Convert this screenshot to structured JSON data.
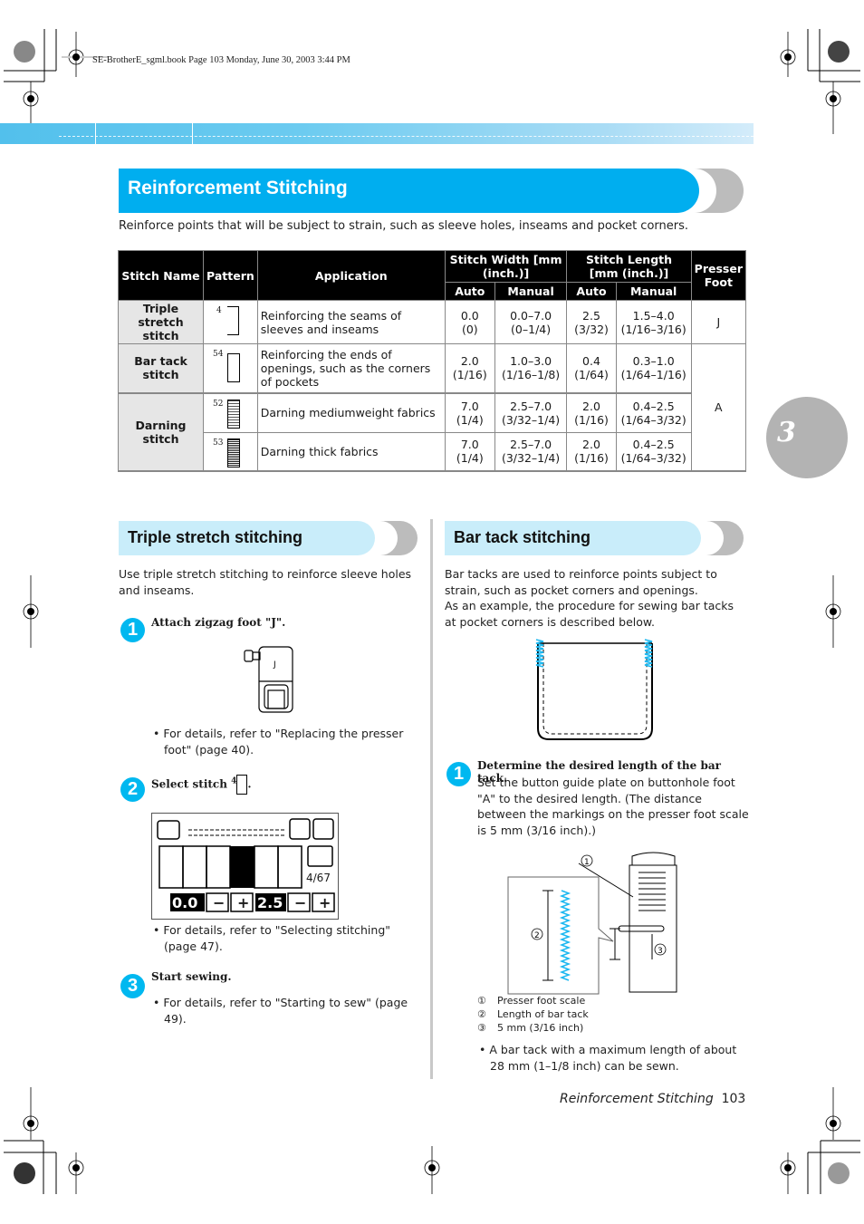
{
  "print_header": "SE-BrotherE_sgml.book  Page 103  Monday, June 30, 2003  3:44 PM",
  "section": {
    "title": "Reinforcement Stitching",
    "intro": "Reinforce points that will be subject to strain, such as sleeve holes, inseams and pocket corners."
  },
  "chapter_number": "3",
  "table": {
    "headers": {
      "stitch_name": "Stitch Name",
      "pattern": "Pattern",
      "application": "Application",
      "stitch_width": "Stitch Width [mm (inch.)]",
      "stitch_length": "Stitch Length [mm (inch.)]",
      "presser_foot": "Presser Foot",
      "auto": "Auto",
      "manual": "Manual"
    },
    "rows": [
      {
        "name": "Triple stretch stitch",
        "pattern_no": "4",
        "application": "Reinforcing the seams of sleeves and inseams",
        "width_auto": "0.0",
        "width_auto_in": "(0)",
        "width_manual": "0.0–7.0",
        "width_manual_in": "(0–1/4)",
        "length_auto": "2.5",
        "length_auto_in": "(3/32)",
        "length_manual": "1.5–4.0",
        "length_manual_in": "(1/16–3/16)",
        "foot": "J"
      },
      {
        "name": "Bar tack stitch",
        "pattern_no": "54",
        "application": "Reinforcing the ends of openings, such as the corners of pockets",
        "width_auto": "2.0",
        "width_auto_in": "(1/16)",
        "width_manual": "1.0–3.0",
        "width_manual_in": "(1/16–1/8)",
        "length_auto": "0.4",
        "length_auto_in": "(1/64)",
        "length_manual": "0.3–1.0",
        "length_manual_in": "(1/64–1/16)",
        "foot": "A"
      },
      {
        "name": "Darning stitch",
        "pattern_no": "52",
        "application": "Darning mediumweight fabrics",
        "width_auto": "7.0",
        "width_auto_in": "(1/4)",
        "width_manual": "2.5–7.0",
        "width_manual_in": "(3/32–1/4)",
        "length_auto": "2.0",
        "length_auto_in": "(1/16)",
        "length_manual": "0.4–2.5",
        "length_manual_in": "(1/64–3/32)"
      },
      {
        "pattern_no": "53",
        "application": "Darning thick fabrics",
        "width_auto": "7.0",
        "width_auto_in": "(1/4)",
        "width_manual": "2.5–7.0",
        "width_manual_in": "(3/32–1/4)",
        "length_auto": "2.0",
        "length_auto_in": "(1/16)",
        "length_manual": "0.4–2.5",
        "length_manual_in": "(1/64–3/32)"
      }
    ]
  },
  "triple": {
    "title": "Triple stretch stitching",
    "intro": "Use triple stretch stitching to reinforce sleeve holes and inseams.",
    "steps": [
      {
        "num": "1",
        "title": "Attach zigzag foot \"J\".",
        "bullet": "For details, refer to \"Replacing the presser foot\" (page 40).",
        "foot_label": "J"
      },
      {
        "num": "2",
        "title": "Select stitch",
        "stitch_no": "4",
        "bullet": "For details, refer to \"Selecting stitching\" (page 47)."
      },
      {
        "num": "3",
        "title": "Start sewing.",
        "bullet": "For details, refer to \"Starting to sew\" (page 49)."
      }
    ],
    "lcd": {
      "width_value": "0.0",
      "length_value": "2.5",
      "pattern_counter": "4/67",
      "minus": "−",
      "plus": "+"
    }
  },
  "bartack": {
    "title": "Bar tack stitching",
    "intro": "Bar tacks are used to reinforce points subject to strain, such as pocket corners and openings.",
    "intro2": "As an example, the procedure for sewing bar tacks at pocket corners is described below.",
    "step1": {
      "num": "1",
      "title": "Determine the desired length of the bar tack.",
      "body": "Set the button guide plate on buttonhole foot \"A\" to the desired length. (The distance between the markings on the presser foot scale is 5 mm (3/16 inch).)"
    },
    "legend": [
      {
        "mark": "①",
        "text": "Presser foot scale"
      },
      {
        "mark": "②",
        "text": "Length of bar tack"
      },
      {
        "mark": "③",
        "text": "5 mm (3/16 inch)"
      }
    ],
    "note": "A bar tack with a maximum length of about 28 mm (1–1/8 inch) can be sewn."
  },
  "footer": {
    "section": "Reinforcement Stitching",
    "page": "103"
  },
  "colors": {
    "accent": "#00aeef",
    "light_accent": "#c9edfa",
    "grey_tab": "#bcbcbc",
    "thread": "#1ab7f0"
  }
}
